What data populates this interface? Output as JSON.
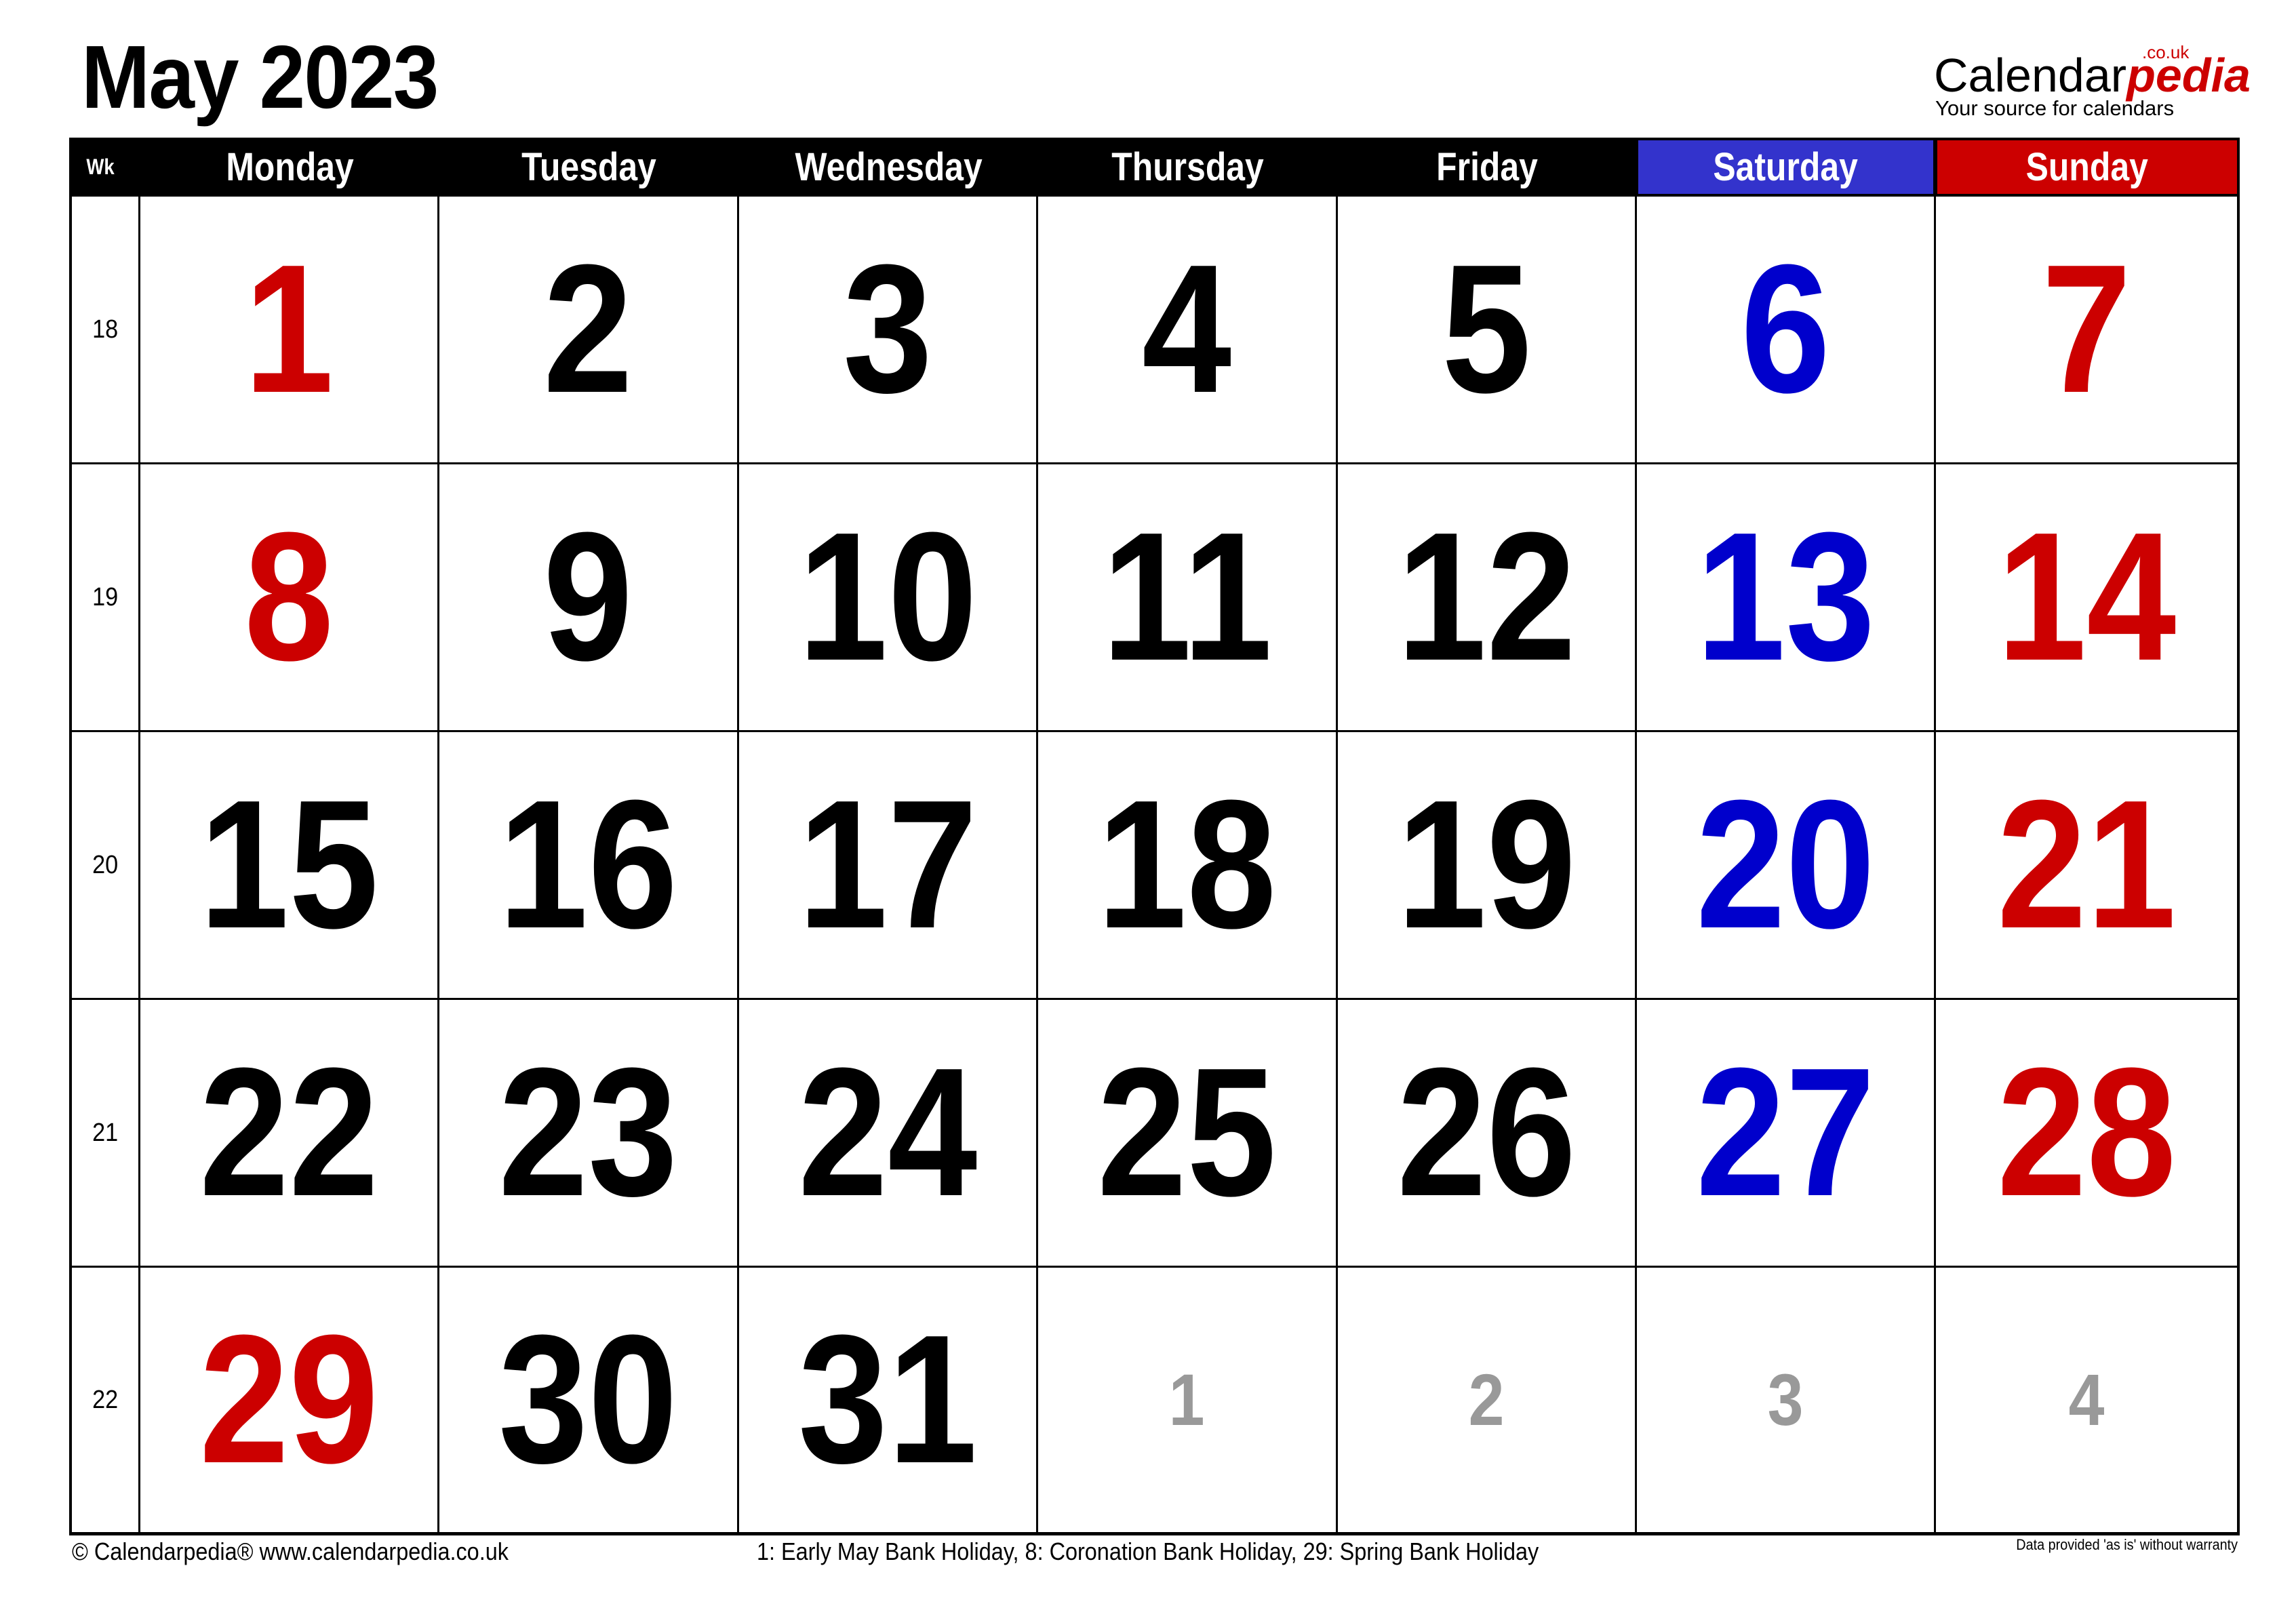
{
  "title": "May 2023",
  "logo": {
    "brand_part1": "Calendar",
    "brand_part2": "pedia",
    "tld": ".co.uk",
    "tagline": "Your source for calendars"
  },
  "colors": {
    "header_bg": "#000000",
    "saturday_header_bg": "#3333cc",
    "sunday_header_bg": "#cc0000",
    "weekday_text": "#000000",
    "saturday_text": "#0000cc",
    "holiday_sunday_text": "#cc0000",
    "other_month_text": "#999999"
  },
  "header": {
    "week_label": "Wk",
    "days": [
      "Monday",
      "Tuesday",
      "Wednesday",
      "Thursday",
      "Friday",
      "Saturday",
      "Sunday"
    ]
  },
  "weeks": [
    {
      "wk": "18",
      "days": [
        {
          "n": "1",
          "type": "holiday"
        },
        {
          "n": "2",
          "type": "weekday"
        },
        {
          "n": "3",
          "type": "weekday"
        },
        {
          "n": "4",
          "type": "weekday"
        },
        {
          "n": "5",
          "type": "weekday"
        },
        {
          "n": "6",
          "type": "saturday"
        },
        {
          "n": "7",
          "type": "sunday"
        }
      ]
    },
    {
      "wk": "19",
      "days": [
        {
          "n": "8",
          "type": "holiday"
        },
        {
          "n": "9",
          "type": "weekday"
        },
        {
          "n": "10",
          "type": "weekday"
        },
        {
          "n": "11",
          "type": "weekday"
        },
        {
          "n": "12",
          "type": "weekday"
        },
        {
          "n": "13",
          "type": "saturday"
        },
        {
          "n": "14",
          "type": "sunday"
        }
      ]
    },
    {
      "wk": "20",
      "days": [
        {
          "n": "15",
          "type": "weekday"
        },
        {
          "n": "16",
          "type": "weekday"
        },
        {
          "n": "17",
          "type": "weekday"
        },
        {
          "n": "18",
          "type": "weekday"
        },
        {
          "n": "19",
          "type": "weekday"
        },
        {
          "n": "20",
          "type": "saturday"
        },
        {
          "n": "21",
          "type": "sunday"
        }
      ]
    },
    {
      "wk": "21",
      "days": [
        {
          "n": "22",
          "type": "weekday"
        },
        {
          "n": "23",
          "type": "weekday"
        },
        {
          "n": "24",
          "type": "weekday"
        },
        {
          "n": "25",
          "type": "weekday"
        },
        {
          "n": "26",
          "type": "weekday"
        },
        {
          "n": "27",
          "type": "saturday"
        },
        {
          "n": "28",
          "type": "sunday"
        }
      ]
    },
    {
      "wk": "22",
      "days": [
        {
          "n": "29",
          "type": "holiday"
        },
        {
          "n": "30",
          "type": "weekday"
        },
        {
          "n": "31",
          "type": "weekday"
        },
        {
          "n": "1",
          "type": "other"
        },
        {
          "n": "2",
          "type": "other"
        },
        {
          "n": "3",
          "type": "other"
        },
        {
          "n": "4",
          "type": "other"
        }
      ]
    }
  ],
  "footer": {
    "copyright": "© Calendarpedia®   www.calendarpedia.co.uk",
    "holidays": "1: Early May Bank Holiday, 8: Coronation Bank Holiday, 29: Spring Bank Holiday",
    "disclaimer": "Data provided 'as is' without warranty"
  }
}
